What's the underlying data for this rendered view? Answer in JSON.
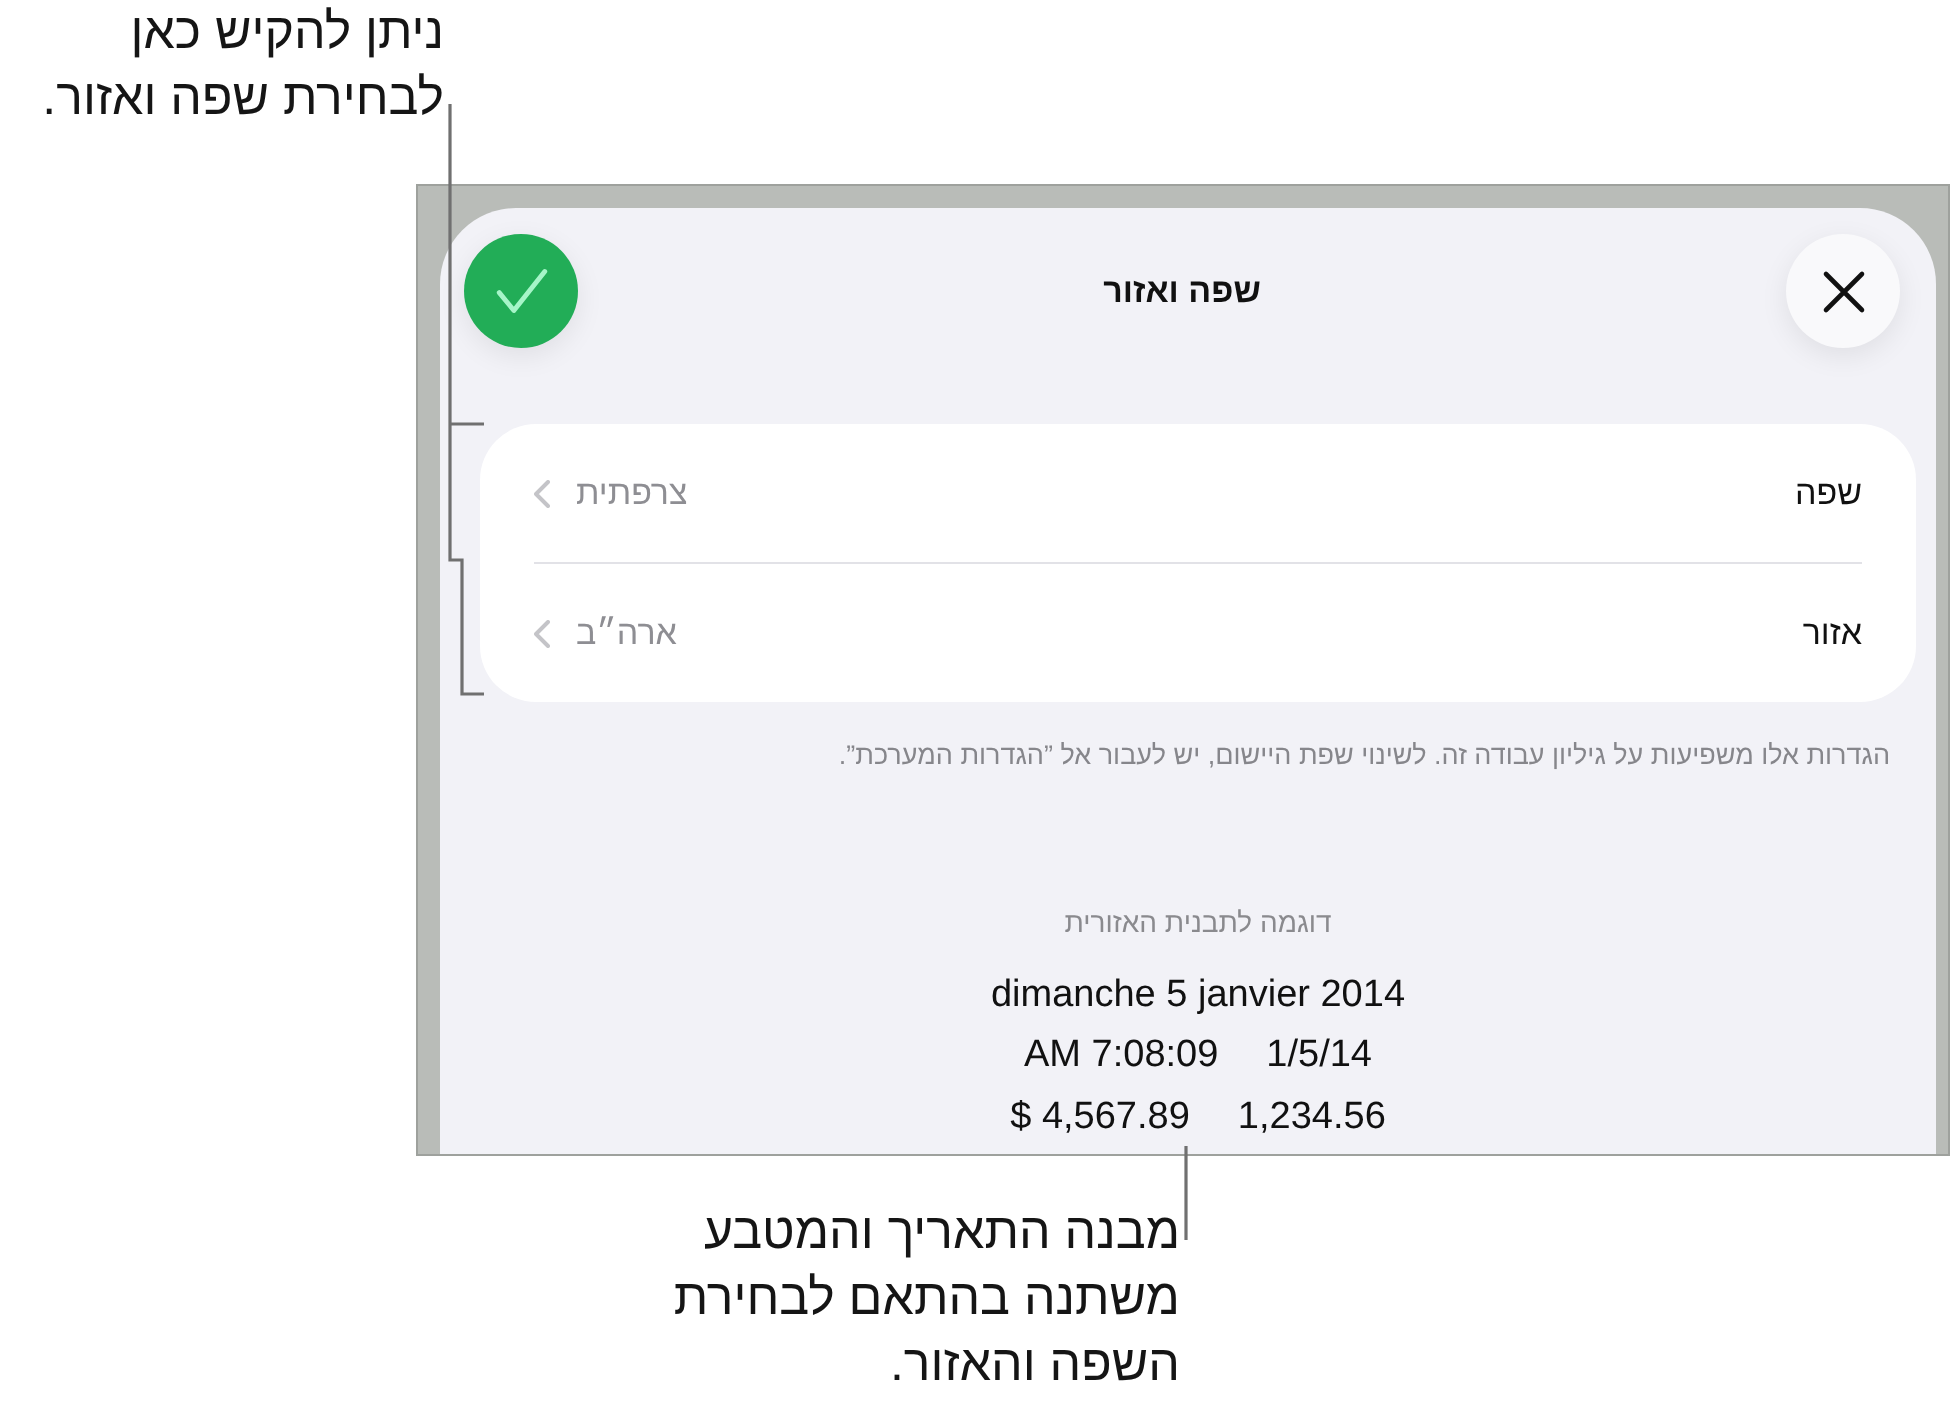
{
  "callout_top": "ניתן להקיש כאן לבחירת שפה ואזור.",
  "sheet": {
    "title": "שפה ואזור"
  },
  "settings": [
    {
      "label": "שפה",
      "value": "צרפתית"
    },
    {
      "label": "אזור",
      "value": "ארה״ב"
    }
  ],
  "note": "הגדרות אלו משפיעות על גיליון עבודה זה. לשינוי שפת היישום, יש לעבור אל ”הגדרות המערכת”.",
  "sample": {
    "heading": "דוגמה לתבנית האזורית",
    "lines": [
      [
        "dimanche 5 janvier 2014"
      ],
      [
        "1/5/14",
        "AM 7:08:09"
      ],
      [
        "1,234.56",
        "$ 4,567.89"
      ]
    ]
  },
  "callout_bottom": "מבנה התאריך והמטבע משתנה בהתאם לבחירת השפה והאזור."
}
